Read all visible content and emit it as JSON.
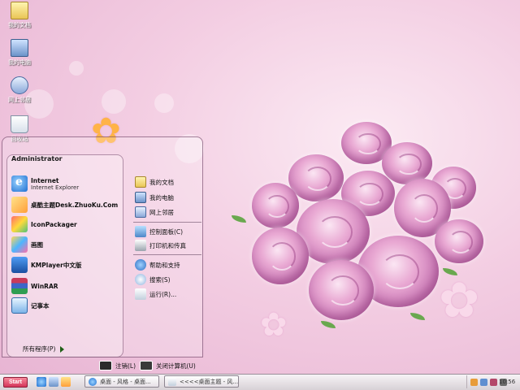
{
  "desktop_icons": [
    {
      "name": "my-documents",
      "label": "我的文档",
      "icon": "folder-doc-icon"
    },
    {
      "name": "my-computer",
      "label": "我的电脑",
      "icon": "computer-icon"
    },
    {
      "name": "network-places",
      "label": "网上邻居",
      "icon": "network-icon"
    },
    {
      "name": "recycle-bin",
      "label": "回收站",
      "icon": "recycle-bin-icon"
    }
  ],
  "start_menu": {
    "user": "Administrator",
    "pinned": [
      {
        "label": "Internet",
        "sub": "Internet Explorer",
        "icon": "ie-icon"
      },
      {
        "label": "桌酷主题Desk.ZhuoKu.Com",
        "icon": "zhuoku-icon"
      },
      {
        "label": "IconPackager",
        "icon": "iconpackager-icon"
      },
      {
        "label": "画图",
        "icon": "paint-icon"
      },
      {
        "label": "KMPlayer中文版",
        "icon": "kmplayer-icon"
      },
      {
        "label": "WinRAR",
        "icon": "winrar-icon"
      },
      {
        "label": "记事本",
        "icon": "notepad-icon"
      }
    ],
    "all_programs": "所有程序(P)",
    "right": [
      {
        "label": "我的文档",
        "icon": "my-documents-icon"
      },
      {
        "label": "我的电脑",
        "icon": "my-computer-icon"
      },
      {
        "label": "网上邻居",
        "icon": "network-places-icon"
      },
      {
        "label": "控制面板(C)",
        "icon": "control-panel-icon"
      },
      {
        "label": "打印机和传真",
        "icon": "printer-icon"
      },
      {
        "label": "帮助和支持",
        "icon": "help-icon"
      },
      {
        "label": "搜索(S)",
        "icon": "search-icon"
      },
      {
        "label": "运行(R)...",
        "icon": "run-icon"
      }
    ],
    "logoff": "注销(L)",
    "shutdown": "关闭计算机(U)"
  },
  "taskbar": {
    "start": "Start",
    "tasks": [
      "桌面 - 风格 - 桌面...",
      "<<<<桌面主题 - 风..."
    ],
    "clock": "10:56"
  }
}
